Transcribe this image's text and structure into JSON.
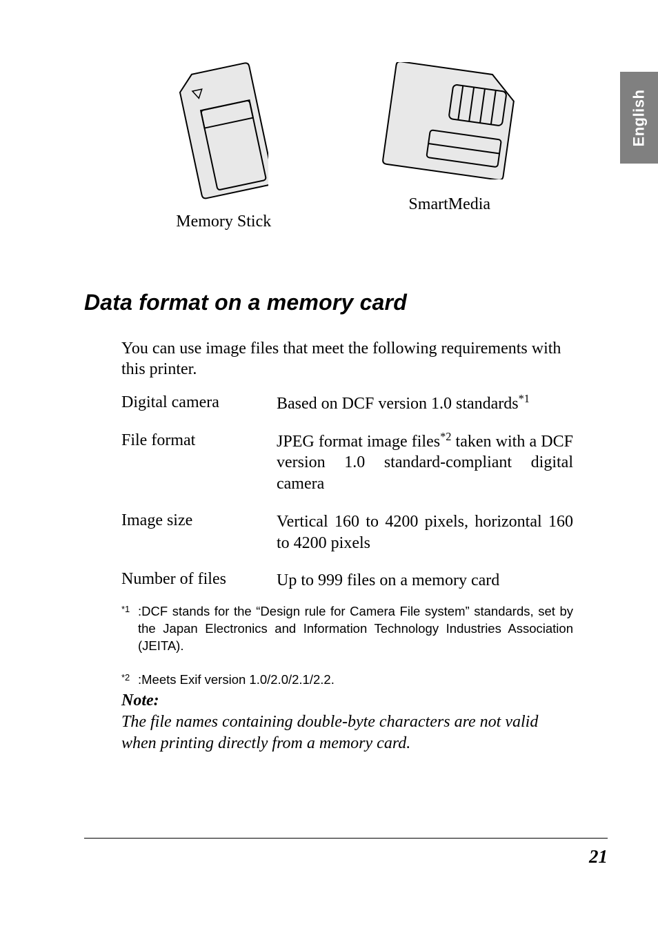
{
  "language_tab": "English",
  "figures": {
    "memory_stick_caption": "Memory Stick",
    "smartmedia_caption": "SmartMedia"
  },
  "section_title": "Data format on a memory card",
  "intro_text": "You can use image files that meet the following requirements with this printer.",
  "specs": {
    "digital_camera": {
      "label": "Digital camera",
      "value_before_sup": "Based on DCF version 1.0 standards",
      "sup": "*1"
    },
    "file_format": {
      "label": "File format",
      "value_before_sup": "JPEG format image files",
      "sup": "*2",
      "value_after_sup": " taken with a DCF version 1.0 standard-compliant digital camera"
    },
    "image_size": {
      "label": "Image size",
      "value": "Vertical 160 to 4200 pixels, horizontal 160 to 4200 pixels"
    },
    "number_of_files": {
      "label": "Number of files",
      "value": "Up to 999 files on a memory card"
    }
  },
  "footnotes": {
    "f1": {
      "mark": "*1",
      "text": ":DCF stands for the “Design rule for Camera File system” standards, set by the Japan Electronics and Information Technology Industries Association (JEITA)."
    },
    "f2": {
      "mark": "*2",
      "text": ":Meets Exif version 1.0/2.0/2.1/2.2."
    }
  },
  "note": {
    "label": "Note:",
    "text": "The file names containing double-byte characters are not valid when printing directly from a memory card."
  },
  "page_number": "21"
}
